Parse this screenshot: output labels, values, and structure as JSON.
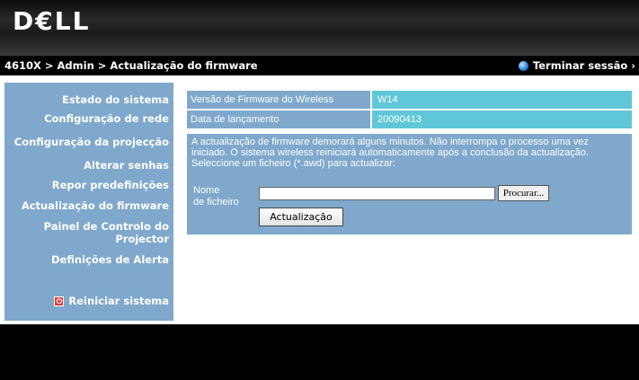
{
  "header": {
    "logo_text": "D€LL"
  },
  "titlebar": {
    "breadcrumb": "4610X > Admin > Actualização do firmware",
    "logout_label": "Terminar sessão ›"
  },
  "sidebar": {
    "items": [
      {
        "label": "Estado do sistema"
      },
      {
        "label": "Configuração de rede"
      },
      {
        "label": "Configuração da projecção"
      },
      {
        "label": "Alterar senhas"
      },
      {
        "label": "Repor predefinições"
      },
      {
        "label": "Actualização do firmware"
      },
      {
        "label": "Painel de Controlo do Projector"
      },
      {
        "label": "Definições de Alerta"
      }
    ],
    "reboot_label": "Reiniciar sistema"
  },
  "firmware_info": {
    "version_label": "Versão de Firmware do Wireless",
    "version_value": "W14",
    "date_label": "Data de lançamento",
    "date_value": "20090413"
  },
  "update": {
    "message": "A actualização de firmware demorará alguns minutos. Não interrompa o processo uma vez iniciado. O sistema wireless reiniciará automaticamente após a conclusão da actualização. Seleccione um ficheiro (*.awd) para actualizar:",
    "filename_label": "Nome de ficheiro",
    "filename_value": "",
    "browse_label": "Procurar...",
    "update_label": "Actualização"
  },
  "colors": {
    "panel_blue": "#7fa8cc",
    "value_cyan": "#5fc7d8",
    "header_black": "#000000"
  }
}
